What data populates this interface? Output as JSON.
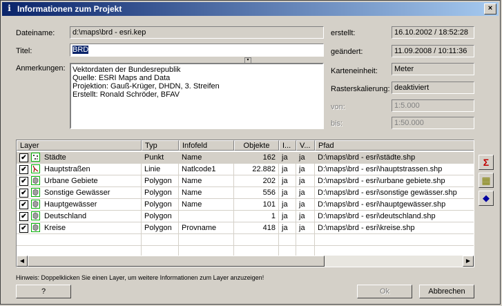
{
  "window": {
    "title": "Informationen zum Projekt",
    "close": "×"
  },
  "form": {
    "dateiname_label": "Dateiname:",
    "dateiname_value": "d:\\maps\\brd - esri.kep",
    "titel_label": "Titel:",
    "titel_value": "BRD",
    "anmerkungen_label": "Anmerkungen:",
    "anmerkungen_lines": [
      "Vektordaten der Bundesrepublik",
      "Quelle: ESRI Maps and Data",
      "Projektion: Gauß-Krüger, DHDN, 3. Streifen",
      "Erstellt: Ronald Schröder, BFAV"
    ],
    "erstellt_label": "erstellt:",
    "erstellt_value": "16.10.2002 / 18:52:28",
    "geaendert_label": "geändert:",
    "geaendert_value": "11.09.2008 / 10:11:36",
    "karteneinheit_label": "Karteneinheit:",
    "karteneinheit_value": "Meter",
    "rasterskalierung_label": "Rasterskalierung:",
    "rasterskalierung_value": "deaktiviert",
    "von_label": "von:",
    "von_value": "1:5.000",
    "bis_label": "bis:",
    "bis_value": "1:50.000"
  },
  "table": {
    "columns": [
      "Layer",
      "Typ",
      "Infofeld",
      "Objekte",
      "I...",
      "V...",
      "Pfad"
    ],
    "rows": [
      {
        "checked": true,
        "layer": "Städte",
        "typ": "Punkt",
        "infofeld": "Name",
        "objekte": "162",
        "i": "ja",
        "v": "ja",
        "pfad": "D:\\maps\\brd - esri\\städte.shp",
        "icon": "point-layer-icon"
      },
      {
        "checked": true,
        "layer": "Hauptstraßen",
        "typ": "Linie",
        "infofeld": "Natlcode1",
        "objekte": "22.882",
        "i": "ja",
        "v": "ja",
        "pfad": "D:\\maps\\brd - esri\\hauptstrassen.shp",
        "icon": "line-layer-icon"
      },
      {
        "checked": true,
        "layer": "Urbane Gebiete",
        "typ": "Polygon",
        "infofeld": "Name",
        "objekte": "202",
        "i": "ja",
        "v": "ja",
        "pfad": "D:\\maps\\brd - esri\\urbane gebiete.shp",
        "icon": "polygon-layer-icon"
      },
      {
        "checked": true,
        "layer": "Sonstige Gewässer",
        "typ": "Polygon",
        "infofeld": "Name",
        "objekte": "556",
        "i": "ja",
        "v": "ja",
        "pfad": "D:\\maps\\brd - esri\\sonstige gewässer.shp",
        "icon": "polygon-layer-icon"
      },
      {
        "checked": true,
        "layer": "Hauptgewässer",
        "typ": "Polygon",
        "infofeld": "Name",
        "objekte": "101",
        "i": "ja",
        "v": "ja",
        "pfad": "D:\\maps\\brd - esri\\hauptgewässer.shp",
        "icon": "polygon-layer-icon"
      },
      {
        "checked": true,
        "layer": "Deutschland",
        "typ": "Polygon",
        "infofeld": "",
        "objekte": "1",
        "i": "ja",
        "v": "ja",
        "pfad": "D:\\maps\\brd - esri\\deutschland.shp",
        "icon": "polygon-layer-icon"
      },
      {
        "checked": true,
        "layer": "Kreise",
        "typ": "Polygon",
        "infofeld": "Provname",
        "objekte": "418",
        "i": "ja",
        "v": "ja",
        "pfad": "D:\\maps\\brd - esri\\kreise.shp",
        "icon": "polygon-layer-icon"
      }
    ]
  },
  "hint": "Hinweis: Doppelklicken Sie einen Layer, um weitere Informationen zum Layer anzuzeigen!",
  "buttons": {
    "help": "?",
    "ok": "Ok",
    "cancel": "Abbrechen"
  },
  "side_buttons": [
    {
      "name": "sum-icon",
      "glyph": "Σ",
      "color": "#c00000"
    },
    {
      "name": "table-grid-icon",
      "glyph": "▦",
      "color": "#808000"
    },
    {
      "name": "layer-gem-icon",
      "glyph": "◆",
      "color": "#0000a0"
    }
  ],
  "colors": {
    "title_start": "#0a246a",
    "title_end": "#a6caf0",
    "selection": "#0a246a",
    "face": "#d4d0c8"
  }
}
